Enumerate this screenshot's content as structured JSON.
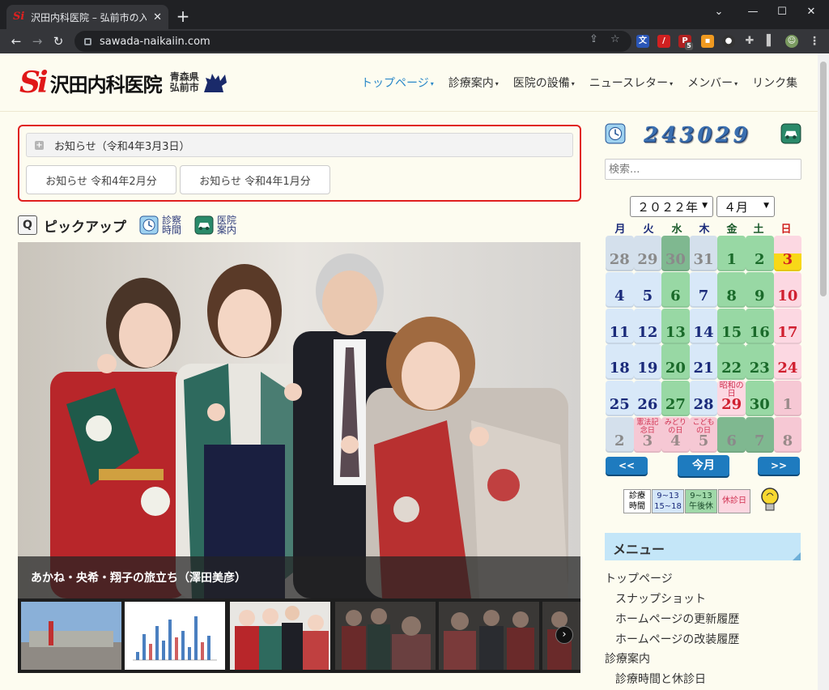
{
  "browser": {
    "tab_title": "沢田内科医院 – 弘前市の入院設備",
    "tab_close": "✕",
    "new_tab": "+",
    "url": "sawada-naikaiin.com",
    "ext_badge": "5"
  },
  "header": {
    "logo_text": "沢田内科医院",
    "logo_sub_1": "青森県",
    "logo_sub_2": "弘前市",
    "nav": [
      {
        "label": "トップページ",
        "caret": "▾"
      },
      {
        "label": "診療案内",
        "caret": "▾"
      },
      {
        "label": "医院の設備",
        "caret": "▾"
      },
      {
        "label": "ニュースレター",
        "caret": "▾"
      },
      {
        "label": "メンバー",
        "caret": "▾"
      },
      {
        "label": "リンク集",
        "caret": ""
      }
    ]
  },
  "news": {
    "accordion_label": "お知らせ（令和4年3月3日）",
    "plus": "+",
    "buttons": [
      "お知らせ 令和4年2月分",
      "お知らせ 令和4年1月分"
    ]
  },
  "pickup": {
    "title": "ピックアップ",
    "link1_line1": "診察",
    "link1_line2": "時間",
    "link2_line1": "医院",
    "link2_line2": "案内"
  },
  "slider": {
    "caption": "あかね・央希・翔子の旅立ち（澤田美彦）",
    "next": "›"
  },
  "sidebar": {
    "counter": "243029",
    "search_placeholder": "検索...",
    "year_select": "２０２２年",
    "month_select": "４月",
    "weekdays": [
      "月",
      "火",
      "水",
      "木",
      "金",
      "土",
      "日"
    ],
    "prev_label": "<<",
    "today_label": "今月",
    "next_label": ">>",
    "legend": {
      "label_1": "診療",
      "label_2": "時間",
      "blue_1": "9~13",
      "blue_2": "15~18",
      "green_1": "9~13",
      "green_2": "午後休",
      "pink": "休診日"
    },
    "menu_title": "メニュー",
    "menu_items": [
      "トップページ",
      "スナップショット",
      "ホームページの更新履歴",
      "ホームページの改装履歴",
      "診療案内",
      "診療時間と休診日"
    ]
  },
  "calendar": {
    "weeks": [
      [
        {
          "d": "28",
          "t": "out"
        },
        {
          "d": "29",
          "t": "out"
        },
        {
          "d": "30",
          "t": "outg"
        },
        {
          "d": "31",
          "t": "out"
        },
        {
          "d": "1",
          "t": "g"
        },
        {
          "d": "2",
          "t": "g"
        },
        {
          "d": "3",
          "t": "today"
        }
      ],
      [
        {
          "d": "4",
          "t": "b"
        },
        {
          "d": "5",
          "t": "b"
        },
        {
          "d": "6",
          "t": "g"
        },
        {
          "d": "7",
          "t": "b"
        },
        {
          "d": "8",
          "t": "g"
        },
        {
          "d": "9",
          "t": "g"
        },
        {
          "d": "10",
          "t": "p"
        }
      ],
      [
        {
          "d": "11",
          "t": "b"
        },
        {
          "d": "12",
          "t": "b"
        },
        {
          "d": "13",
          "t": "g"
        },
        {
          "d": "14",
          "t": "b"
        },
        {
          "d": "15",
          "t": "g"
        },
        {
          "d": "16",
          "t": "g"
        },
        {
          "d": "17",
          "t": "p"
        }
      ],
      [
        {
          "d": "18",
          "t": "b"
        },
        {
          "d": "19",
          "t": "b"
        },
        {
          "d": "20",
          "t": "g"
        },
        {
          "d": "21",
          "t": "b"
        },
        {
          "d": "22",
          "t": "g"
        },
        {
          "d": "23",
          "t": "g"
        },
        {
          "d": "24",
          "t": "p"
        }
      ],
      [
        {
          "d": "25",
          "t": "b"
        },
        {
          "d": "26",
          "t": "b"
        },
        {
          "d": "27",
          "t": "g"
        },
        {
          "d": "28",
          "t": "b"
        },
        {
          "d": "29",
          "t": "ph",
          "h": "昭和の日"
        },
        {
          "d": "30",
          "t": "g"
        },
        {
          "d": "1",
          "t": "outp"
        }
      ],
      [
        {
          "d": "2",
          "t": "out"
        },
        {
          "d": "3",
          "t": "outp",
          "h": "憲法記念日"
        },
        {
          "d": "4",
          "t": "outp",
          "h": "みどりの日"
        },
        {
          "d": "5",
          "t": "outp",
          "h": "こどもの日"
        },
        {
          "d": "6",
          "t": "outg"
        },
        {
          "d": "7",
          "t": "outg"
        },
        {
          "d": "8",
          "t": "outp"
        }
      ]
    ]
  }
}
